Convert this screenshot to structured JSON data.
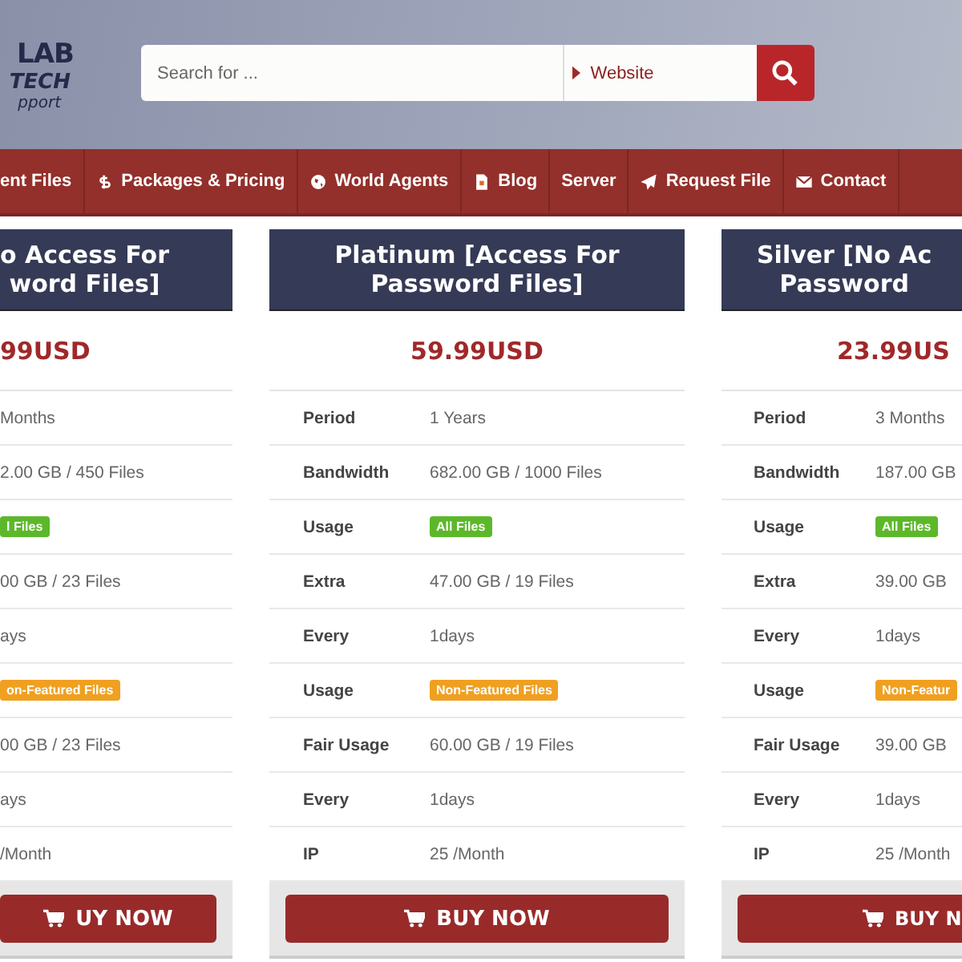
{
  "logo": {
    "line_1": "LAB",
    "line_2": "TECH",
    "line_3": "pport"
  },
  "search": {
    "placeholder": "Search for ...",
    "scope": "Website"
  },
  "nav": [
    {
      "label": "ent Files"
    },
    {
      "label": "Packages & Pricing"
    },
    {
      "label": "World Agents"
    },
    {
      "label": "Blog"
    },
    {
      "label": "Server"
    },
    {
      "label": "Request File"
    },
    {
      "label": "Contact"
    }
  ],
  "cards": [
    {
      "title_lines": [
        "o Access For",
        "word Files]"
      ],
      "price": "99USD",
      "button": "UY NOW",
      "rows": [
        {
          "kind": "text",
          "value": "Months"
        },
        {
          "kind": "text",
          "value": "2.00 GB / 450 Files"
        },
        {
          "kind": "badge",
          "value": "l Files",
          "color": "#5cb82a"
        },
        {
          "kind": "text",
          "value": "00 GB / 23 Files"
        },
        {
          "kind": "text",
          "value": "ays"
        },
        {
          "kind": "badge",
          "value": "on-Featured Files",
          "color": "#f0a020"
        },
        {
          "kind": "text",
          "value": "00 GB / 23 Files"
        },
        {
          "kind": "text",
          "value": "ays"
        },
        {
          "kind": "text",
          "value": "/Month"
        }
      ]
    },
    {
      "title_lines": [
        "Platinum [Access For",
        "Password Files]"
      ],
      "price": "59.99USD",
      "button": "BUY NOW",
      "rows": [
        {
          "kind": "text",
          "label": "Period",
          "value": "1 Years"
        },
        {
          "kind": "text",
          "label": "Bandwidth",
          "value": "682.00 GB / 1000 Files"
        },
        {
          "kind": "badge",
          "label": "Usage",
          "value": "All Files",
          "color": "#5cb82a"
        },
        {
          "kind": "text",
          "label": "Extra",
          "value": "47.00 GB / 19 Files"
        },
        {
          "kind": "text",
          "label": "Every",
          "value": "1days"
        },
        {
          "kind": "badge",
          "label": "Usage",
          "value": "Non-Featured Files",
          "color": "#f0a020"
        },
        {
          "kind": "text",
          "label": "Fair Usage",
          "value": "60.00 GB / 19 Files"
        },
        {
          "kind": "text",
          "label": "Every",
          "value": "1days"
        },
        {
          "kind": "text",
          "label": "IP",
          "value": "25 /Month"
        }
      ]
    },
    {
      "title_lines": [
        "Silver [No Ac",
        "Password"
      ],
      "price": "23.99US",
      "button": "BUY N",
      "rows": [
        {
          "kind": "text",
          "label": "Period",
          "value": "3 Months"
        },
        {
          "kind": "text",
          "label": "Bandwidth",
          "value": "187.00 GB"
        },
        {
          "kind": "badge",
          "label": "Usage",
          "value": "All Files",
          "color": "#5cb82a"
        },
        {
          "kind": "text",
          "label": "Extra",
          "value": "39.00 GB"
        },
        {
          "kind": "text",
          "label": "Every",
          "value": "1days"
        },
        {
          "kind": "badge",
          "label": "Usage",
          "value": "Non-Featur",
          "color": "#f0a020"
        },
        {
          "kind": "text",
          "label": "Fair Usage",
          "value": "39.00 GB"
        },
        {
          "kind": "text",
          "label": "Every",
          "value": "1days"
        },
        {
          "kind": "text",
          "label": "IP",
          "value": "25 /Month"
        }
      ]
    }
  ]
}
